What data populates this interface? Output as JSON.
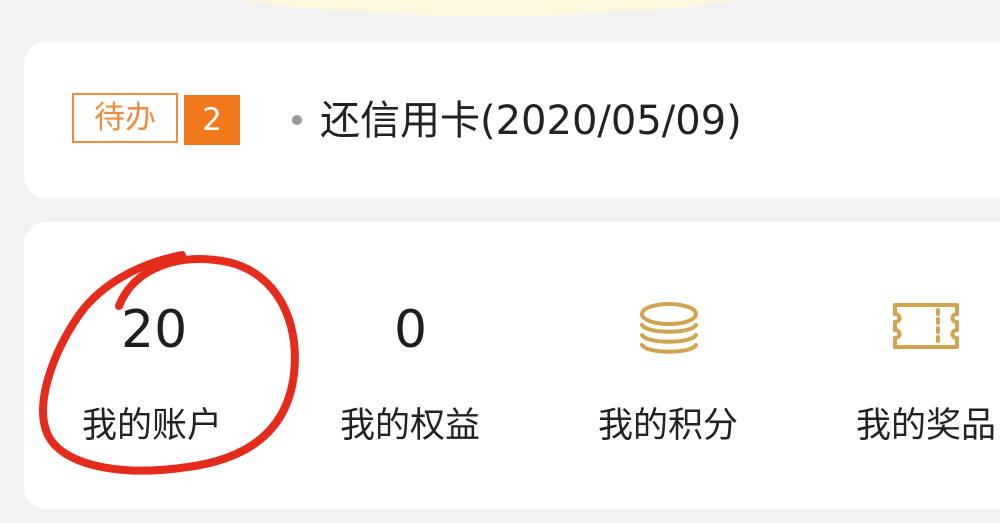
{
  "todo": {
    "tag": "待办",
    "count": "2",
    "item": "还信用卡(2020/05/09)"
  },
  "assets": [
    {
      "value": "20",
      "label": "我的账户"
    },
    {
      "value": "0",
      "label": "我的权益"
    },
    {
      "icon": "coin-stack-icon",
      "label": "我的积分"
    },
    {
      "icon": "ticket-icon",
      "label": "我的奖品"
    }
  ],
  "colors": {
    "accent_orange": "#f27a1d",
    "outline_orange": "#ef8a3d",
    "icon_gold": "#d2a44f",
    "annotation_red": "#e52b1c"
  }
}
